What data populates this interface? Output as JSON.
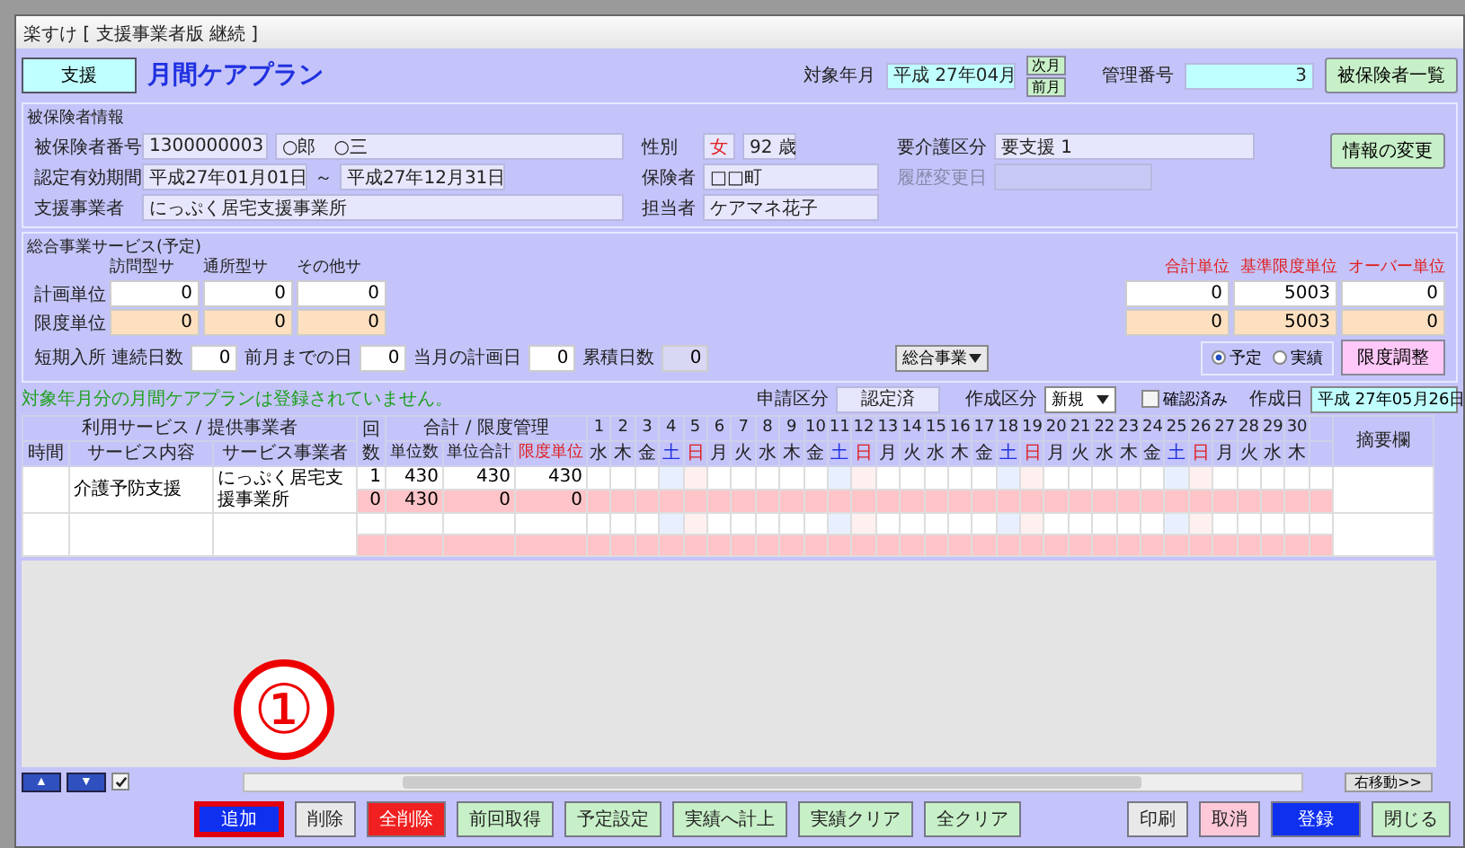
{
  "window": {
    "title": "楽すけ [ 支援事業者版 継続 ]"
  },
  "header": {
    "mode_badge": "支援",
    "title": "月間ケアプラン",
    "target_month_label": "対象年月",
    "target_month": "平成 27年04月",
    "next_month": "次月",
    "prev_month": "前月",
    "mgmt_no_label": "管理番号",
    "mgmt_no": "3",
    "insured_list_button": "被保険者一覧"
  },
  "insured_info": {
    "legend": "被保険者情報",
    "number_label": "被保険者番号",
    "number": "1300000003",
    "name": "○郎　○三",
    "validity_label": "認定有効期間",
    "valid_from": "平成27年01月01日",
    "tilde": "～",
    "valid_to": "平成27年12月31日",
    "provider_label": "支援事業者",
    "provider": "にっぷく居宅支援事業所",
    "gender_label": "性別",
    "gender": "女",
    "age": "92 歳",
    "insurer_label": "保険者",
    "insurer": "□□町",
    "manager_label": "担当者",
    "manager": "ケアマネ花子",
    "care_level_label": "要介護区分",
    "care_level": "要支援 1",
    "history_label": "履歴変更日",
    "history_disabled": true,
    "change_button": "情報の変更"
  },
  "services": {
    "legend": "総合事業サービス(予定)",
    "columns": [
      "訪問型サ",
      "通所型サ",
      "その他サ"
    ],
    "total_columns": [
      "合計単位",
      "基準限度単位",
      "オーバー単位"
    ],
    "rows": [
      {
        "label": "計画単位",
        "kind": "plan",
        "values": [
          "0",
          "0",
          "0"
        ],
        "totals": [
          "0",
          "5003",
          "0"
        ]
      },
      {
        "label": "限度単位",
        "kind": "limit",
        "values": [
          "0",
          "0",
          "0"
        ],
        "totals": [
          "0",
          "5003",
          "0"
        ]
      }
    ],
    "short_stay": [
      {
        "label": "短期入所 連続日数",
        "value": "0",
        "disabled": false
      },
      {
        "label": "前月までの日",
        "value": "0",
        "disabled": false
      },
      {
        "label": "当月の計画日",
        "value": "0",
        "disabled": false
      },
      {
        "label": "累積日数",
        "value": "0",
        "disabled": true
      }
    ],
    "category_select": "総合事業",
    "radios": [
      {
        "label": "予定",
        "selected": true
      },
      {
        "label": "実績",
        "selected": false
      }
    ],
    "limit_button": "限度調整"
  },
  "message": "対象年月分の月間ケアプランは登録されていません。",
  "grid_toolbar": {
    "application_label": "申請区分",
    "application": "認定済",
    "creation_label": "作成区分",
    "creation": "新規",
    "confirmed_label": "確認済み",
    "confirmed": false,
    "date_label": "作成日",
    "date": "平成 27年05月26日"
  },
  "grid": {
    "group1": "利用サービス / 提供事業者",
    "count_header": "回数",
    "group2": "合計 / 限度管理",
    "columns": [
      "時間",
      "サービス内容",
      "サービス事業者"
    ],
    "unit_columns": [
      "単位数",
      "単位合計",
      "限度単位"
    ],
    "remarks": "摘要欄",
    "days": [
      {
        "d": "1",
        "w": "水",
        "kind": "weekday"
      },
      {
        "d": "2",
        "w": "木",
        "kind": "weekday"
      },
      {
        "d": "3",
        "w": "金",
        "kind": "weekday"
      },
      {
        "d": "4",
        "w": "土",
        "kind": "sat"
      },
      {
        "d": "5",
        "w": "日",
        "kind": "sun"
      },
      {
        "d": "6",
        "w": "月",
        "kind": "weekday"
      },
      {
        "d": "7",
        "w": "火",
        "kind": "weekday"
      },
      {
        "d": "8",
        "w": "水",
        "kind": "weekday"
      },
      {
        "d": "9",
        "w": "木",
        "kind": "weekday"
      },
      {
        "d": "10",
        "w": "金",
        "kind": "weekday"
      },
      {
        "d": "11",
        "w": "土",
        "kind": "sat"
      },
      {
        "d": "12",
        "w": "日",
        "kind": "sun"
      },
      {
        "d": "13",
        "w": "月",
        "kind": "weekday"
      },
      {
        "d": "14",
        "w": "火",
        "kind": "weekday"
      },
      {
        "d": "15",
        "w": "水",
        "kind": "weekday"
      },
      {
        "d": "16",
        "w": "木",
        "kind": "weekday"
      },
      {
        "d": "17",
        "w": "金",
        "kind": "weekday"
      },
      {
        "d": "18",
        "w": "土",
        "kind": "sat"
      },
      {
        "d": "19",
        "w": "日",
        "kind": "sun"
      },
      {
        "d": "20",
        "w": "月",
        "kind": "weekday"
      },
      {
        "d": "21",
        "w": "火",
        "kind": "weekday"
      },
      {
        "d": "22",
        "w": "水",
        "kind": "weekday"
      },
      {
        "d": "23",
        "w": "木",
        "kind": "weekday"
      },
      {
        "d": "24",
        "w": "金",
        "kind": "weekday"
      },
      {
        "d": "25",
        "w": "土",
        "kind": "sat"
      },
      {
        "d": "26",
        "w": "日",
        "kind": "sun"
      },
      {
        "d": "27",
        "w": "月",
        "kind": "weekday"
      },
      {
        "d": "28",
        "w": "火",
        "kind": "weekday"
      },
      {
        "d": "29",
        "w": "水",
        "kind": "weekday"
      },
      {
        "d": "30",
        "w": "木",
        "kind": "weekday"
      }
    ],
    "rows": [
      {
        "service": "介護予防支援",
        "provider": "にっぷく居宅支援事業所",
        "plan": [
          "1",
          "430",
          "430",
          "430"
        ],
        "actual": [
          "0",
          "430",
          "0",
          "0"
        ]
      },
      {}
    ]
  },
  "nav": {
    "up": "▲",
    "down": "▼",
    "auto_checked": true,
    "scroll_right": "右移動>>"
  },
  "buttons": [
    {
      "label": "追加",
      "kind": "primary",
      "highlighted": true
    },
    {
      "label": "削除",
      "kind": "plain",
      "highlighted": false
    },
    {
      "label": "全削除",
      "kind": "danger",
      "highlighted": false
    },
    {
      "label": "前回取得",
      "kind": "normal",
      "highlighted": false
    },
    {
      "label": "予定設定",
      "kind": "normal",
      "highlighted": false
    },
    {
      "label": "実績へ計上",
      "kind": "normal",
      "highlighted": false
    },
    {
      "label": "実績クリア",
      "kind": "normal",
      "highlighted": false
    },
    {
      "label": "全クリア",
      "kind": "normal",
      "highlighted": false
    },
    {
      "label": "印刷",
      "kind": "gap",
      "highlighted": false
    },
    {
      "label": "取消",
      "kind": "cancel",
      "highlighted": false
    },
    {
      "label": "登録",
      "kind": "primary",
      "highlighted": false
    },
    {
      "label": "閉じる",
      "kind": "normal",
      "highlighted": false
    }
  ],
  "annotation": {
    "mark": "①"
  }
}
